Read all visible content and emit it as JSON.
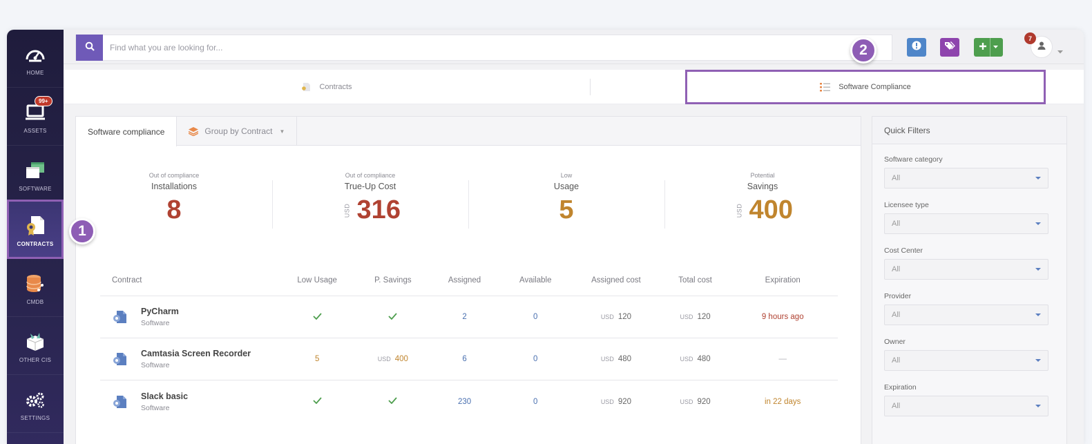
{
  "sidebar": {
    "items": [
      {
        "label": "HOME",
        "icon": "gauge-icon"
      },
      {
        "label": "ASSETS",
        "icon": "laptop-icon",
        "badge": "99+"
      },
      {
        "label": "SOFTWARE",
        "icon": "software-windows-icon"
      },
      {
        "label": "CONTRACTS",
        "icon": "contract-document-icon"
      },
      {
        "label": "CMDB",
        "icon": "database-icon"
      },
      {
        "label": "OTHER CIs",
        "icon": "box-icon"
      },
      {
        "label": "SETTINGS",
        "icon": "gears-icon"
      }
    ],
    "active": "CONTRACTS"
  },
  "callouts": {
    "one": "1",
    "two": "2"
  },
  "search": {
    "placeholder": "Find what you are looking for..."
  },
  "user": {
    "notifications": "7"
  },
  "top_tabs": {
    "contracts": "Contracts",
    "software_compliance": "Software Compliance"
  },
  "panel": {
    "tab_software_compliance": "Software compliance",
    "tab_group_by": "Group by Contract"
  },
  "stats": {
    "installations": {
      "sub": "Out of compliance",
      "title": "Installations",
      "value": "8"
    },
    "trueup": {
      "sub": "Out of compliance",
      "title": "True-Up Cost",
      "currency": "USD",
      "value": "316"
    },
    "usage": {
      "sub": "Low",
      "title": "Usage",
      "value": "5"
    },
    "savings": {
      "sub": "Potential",
      "title": "Savings",
      "currency": "USD",
      "value": "400"
    }
  },
  "table": {
    "headers": {
      "contract": "Contract",
      "low_usage": "Low Usage",
      "p_savings": "P. Savings",
      "assigned": "Assigned",
      "available": "Available",
      "assigned_cost": "Assigned cost",
      "total_cost": "Total cost",
      "expiration": "Expiration"
    },
    "currency": "USD",
    "rows": [
      {
        "name": "PyCharm",
        "type": "Software",
        "low_usage": "check",
        "savings": "check",
        "assigned": "2",
        "available": "0",
        "assigned_cost": "120",
        "total_cost": "120",
        "expiration": "9 hours ago"
      },
      {
        "name": "Camtasia Screen Recorder",
        "type": "Software",
        "low_usage": "5",
        "savings_currency": "USD",
        "savings": "400",
        "assigned": "6",
        "available": "0",
        "assigned_cost": "480",
        "total_cost": "480",
        "expiration": "—"
      },
      {
        "name": "Slack basic",
        "type": "Software",
        "low_usage": "check",
        "savings": "check",
        "assigned": "230",
        "available": "0",
        "assigned_cost": "920",
        "total_cost": "920",
        "expiration": "in 22 days"
      }
    ]
  },
  "filters": {
    "title": "Quick Filters",
    "groups": [
      {
        "label": "Software category",
        "value": "All"
      },
      {
        "label": "Licensee type",
        "value": "All"
      },
      {
        "label": "Cost Center",
        "value": "All"
      },
      {
        "label": "Provider",
        "value": "All"
      },
      {
        "label": "Owner",
        "value": "All"
      },
      {
        "label": "Expiration",
        "value": "All"
      }
    ]
  },
  "colors": {
    "accent": "#8e5db5",
    "search_btn": "#6f5ab8",
    "value_red": "#b04232",
    "value_orange": "#c0852e",
    "link_blue": "#4a70b0"
  }
}
